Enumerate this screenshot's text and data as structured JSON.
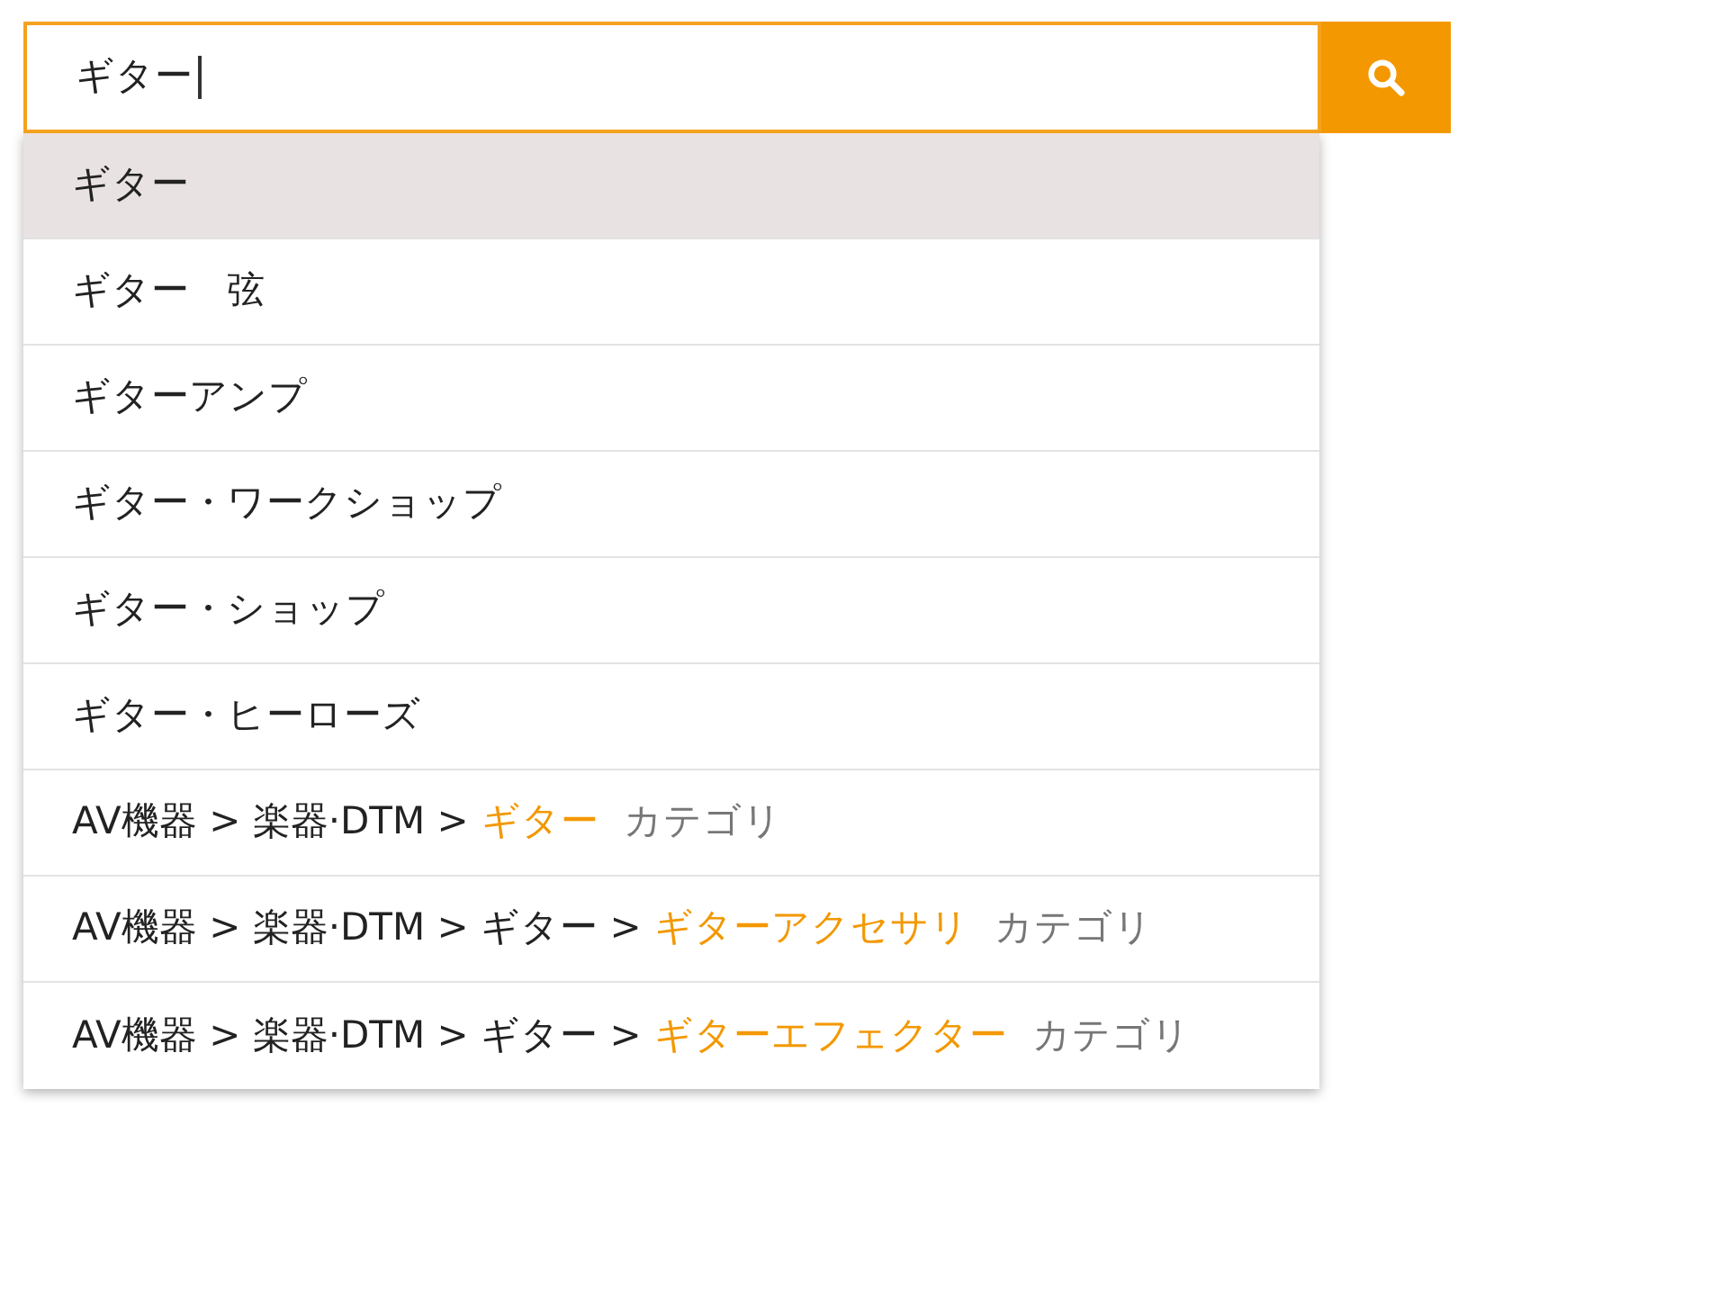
{
  "search": {
    "value": "ギター",
    "focused": true
  },
  "suggestions": [
    {
      "kind": "keyword",
      "text": "ギター",
      "selected": true
    },
    {
      "kind": "keyword",
      "text": "ギター　弦",
      "selected": false
    },
    {
      "kind": "keyword",
      "text": "ギターアンプ",
      "selected": false
    },
    {
      "kind": "keyword",
      "text": "ギター・ワークショップ",
      "selected": false
    },
    {
      "kind": "keyword",
      "text": "ギター・ショップ",
      "selected": false
    },
    {
      "kind": "keyword",
      "text": "ギター・ヒーローズ",
      "selected": false
    },
    {
      "kind": "category",
      "path": "AV機器 > 楽器·DTM >",
      "match": "ギター",
      "tag": "カテゴリ",
      "selected": false
    },
    {
      "kind": "category",
      "path": "AV機器 > 楽器·DTM > ギター >",
      "match": "ギターアクセサリ",
      "tag": "カテゴリ",
      "selected": false
    },
    {
      "kind": "category",
      "path": "AV機器 > 楽器·DTM > ギター >",
      "match": "ギターエフェクター",
      "tag": "カテゴリ",
      "selected": false
    }
  ]
}
